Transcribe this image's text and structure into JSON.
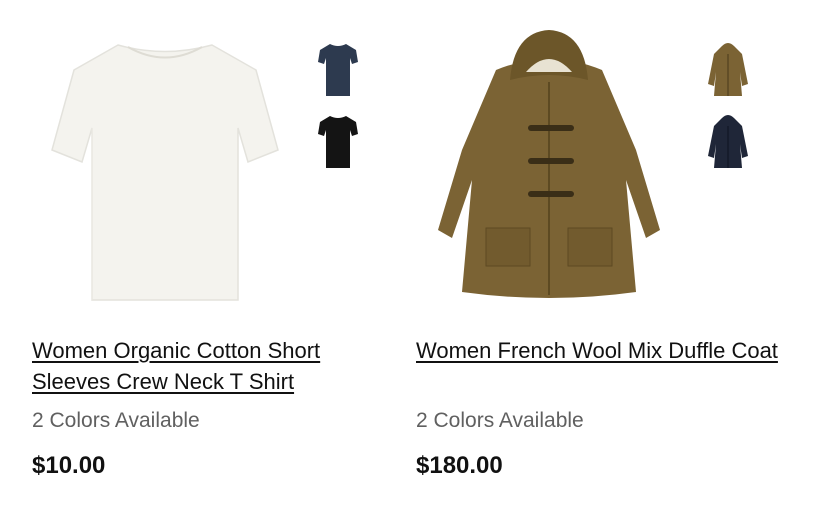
{
  "products": [
    {
      "title": "Women Organic Cotton Short Sleeves Crew Neck T Shirt",
      "colors_available": "2 Colors Available",
      "price": "$10.00",
      "image_icon": "white-tshirt-image",
      "swatches": [
        {
          "name": "navy-tshirt-swatch",
          "color": "#2d3a4f"
        },
        {
          "name": "black-tshirt-swatch",
          "color": "#141414"
        }
      ]
    },
    {
      "title": "Women French Wool Mix Duffle Coat",
      "colors_available": "2 Colors Available",
      "price": "$180.00",
      "image_icon": "brown-duffle-coat-image",
      "swatches": [
        {
          "name": "brown-coat-swatch",
          "color": "#7b6334"
        },
        {
          "name": "navy-coat-swatch",
          "color": "#1f2638"
        }
      ]
    }
  ]
}
